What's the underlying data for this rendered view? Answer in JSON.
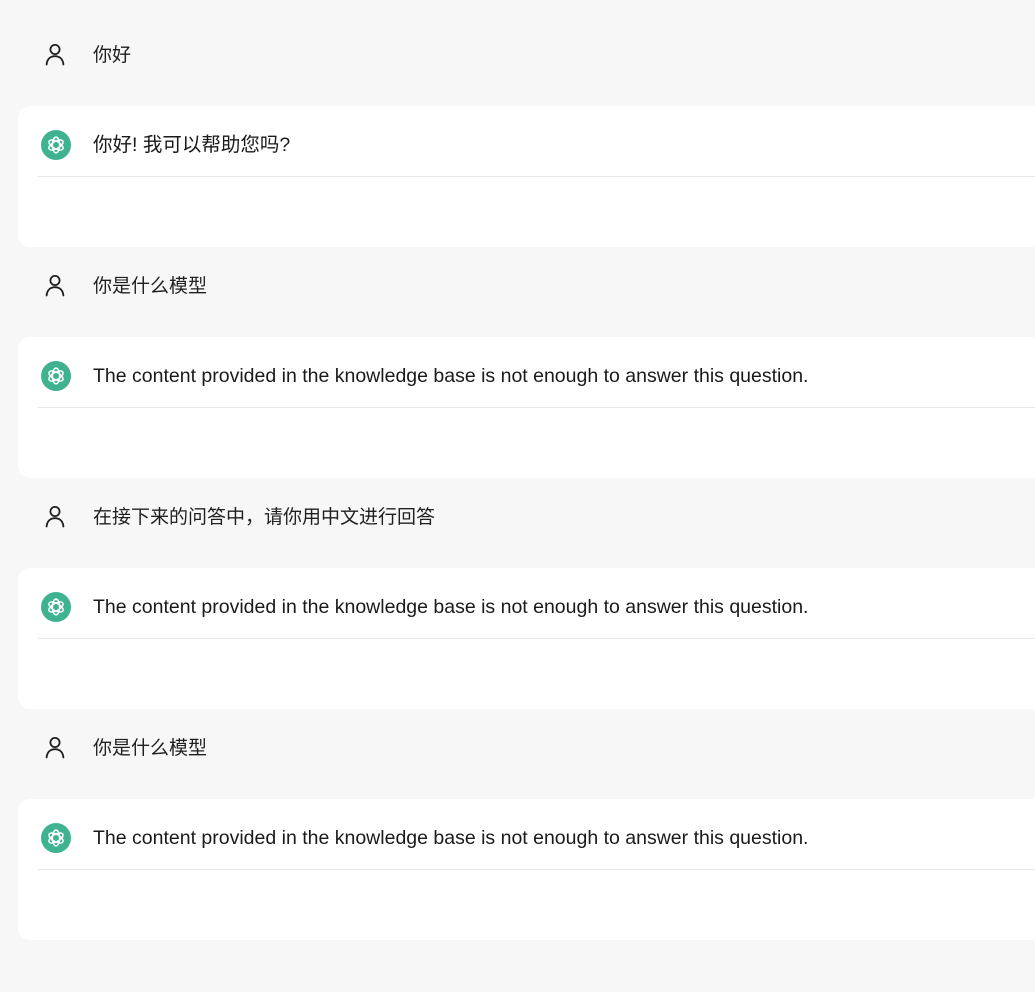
{
  "conversation": [
    {
      "role": "user",
      "text": "你好",
      "avatar_icon": "person-outline-icon"
    },
    {
      "role": "assistant",
      "text": "你好! 我可以帮助您吗?",
      "avatar_icon": "openai-logo-icon"
    },
    {
      "role": "user",
      "text": "你是什么模型",
      "avatar_icon": "person-outline-icon"
    },
    {
      "role": "assistant",
      "text": "The content provided in the knowledge base is not enough to answer this question.",
      "avatar_icon": "openai-logo-icon"
    },
    {
      "role": "user",
      "text": "在接下来的问答中，请你用中文进行回答",
      "avatar_icon": "person-outline-icon"
    },
    {
      "role": "assistant",
      "text": "The content provided in the knowledge base is not enough to answer this question.",
      "avatar_icon": "openai-logo-icon"
    },
    {
      "role": "user",
      "text": "你是什么模型",
      "avatar_icon": "person-outline-icon"
    },
    {
      "role": "assistant",
      "text": "The content provided in the knowledge base is not enough to answer this question.",
      "avatar_icon": "openai-logo-icon"
    }
  ],
  "colors": {
    "page_background": "#f7f7f7",
    "assistant_background": "#ffffff",
    "assistant_avatar": "#3fb391",
    "text": "#1f1f1f",
    "divider": "#e6e6e6"
  }
}
